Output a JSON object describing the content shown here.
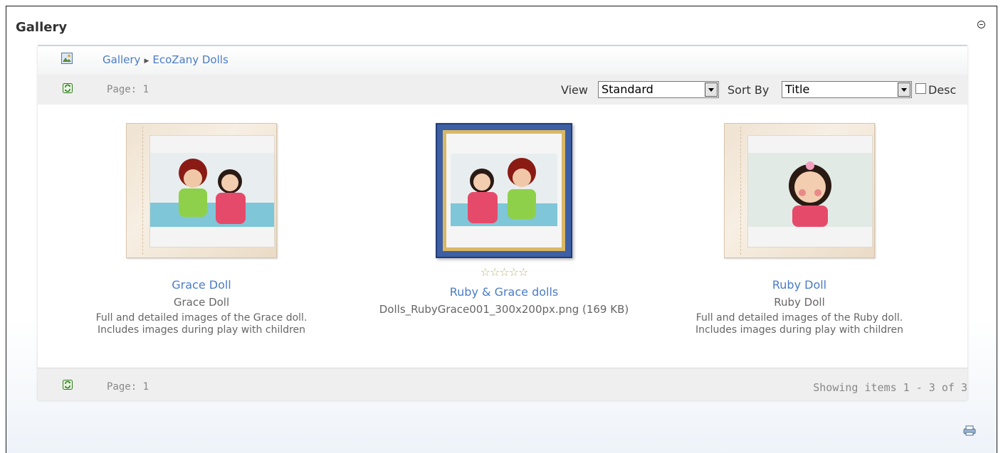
{
  "module": {
    "title": "Gallery"
  },
  "breadcrumb": {
    "root": "Gallery",
    "current": "EcoZany Dolls"
  },
  "top_bar": {
    "page_label": "Page: 1",
    "view_label": "View",
    "view_selected": "Standard",
    "sort_label": "Sort By",
    "sort_selected": "Title",
    "desc_label": "Desc"
  },
  "items": [
    {
      "title": "Grace Doll",
      "subtitle": "Grace Doll",
      "description_1": "Full and detailed images of the Grace doll.",
      "description_2": "Includes images during play with children"
    },
    {
      "rating_stars": "☆☆☆☆☆",
      "title": "Ruby & Grace dolls",
      "file_info": "Dolls_RubyGrace001_300x200px.png (169 KB)"
    },
    {
      "title": "Ruby Doll",
      "subtitle": "Ruby Doll",
      "description_1": "Full and detailed images of the Ruby doll.",
      "description_2": "Includes images during play with children"
    }
  ],
  "bottom_bar": {
    "page_label": "Page: 1",
    "showing": "Showing items 1 - 3 of 3"
  },
  "colors": {
    "link": "#4a7cc6",
    "bar": "#efefef",
    "frame": "#3d5fa3"
  }
}
